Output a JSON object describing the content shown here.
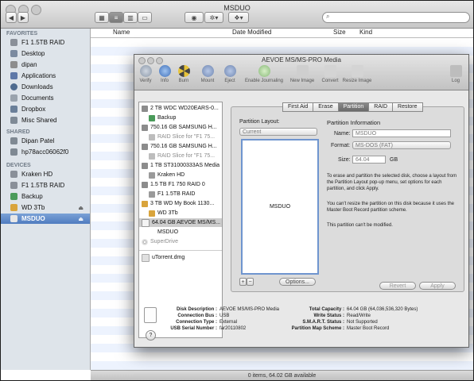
{
  "finder": {
    "title": "MSDUO",
    "columns": {
      "name": "Name",
      "date": "Date Modified",
      "size": "Size",
      "kind": "Kind"
    },
    "status": "0 items, 64.02 GB available",
    "sidebar": {
      "favorites_head": "FAVORITES",
      "shared_head": "SHARED",
      "devices_head": "DEVICES",
      "favorites": [
        "F1 1.5TB RAID",
        "Desktop",
        "dipan",
        "Applications",
        "Downloads",
        "Documents",
        "Dropbox",
        "Misc Shared"
      ],
      "shared": [
        "Dipan Patel",
        "hp78acc06062f0"
      ],
      "devices": [
        "Kraken HD",
        "F1 1.5TB RAID",
        "Backup",
        "WD 3Tb",
        "MSDUO"
      ],
      "eject": "⏏"
    }
  },
  "du": {
    "title": "AEVOE MS/MS-PRO Media",
    "toolbar": [
      "Verify",
      "Info",
      "Burn",
      "Mount",
      "Eject",
      "Enable Journaling",
      "New Image",
      "Convert",
      "Resize Image",
      "Log"
    ],
    "disks": [
      "2 TB WDC WD20EARS-0...",
      "Backup",
      "750.16 GB SAMSUNG H...",
      "RAID Slice for \"F1 75...",
      "750.16 GB SAMSUNG H...",
      "RAID Slice for \"F1 75...",
      "1 TB ST31000333AS Media",
      "Kraken HD",
      "1.5 TB F1 750 RAID 0",
      "F1 1.5TB RAID",
      "3 TB WD My Book 1130...",
      "WD 3Tb",
      "64.04 GB AEVOE MS/MS...",
      "MSDUO",
      "SuperDrive",
      "uTorrent.dmg"
    ],
    "tabs": [
      "First Aid",
      "Erase",
      "Partition",
      "RAID",
      "Restore"
    ],
    "partition": {
      "layout_label": "Partition Layout:",
      "layout_value": "Current",
      "partition_name": "MSDUO",
      "info_title": "Partition Information",
      "name_label": "Name:",
      "name_value": "MSDUO",
      "format_label": "Format:",
      "format_value": "MS-DOS (FAT)",
      "size_label": "Size:",
      "size_value": "64.04",
      "size_unit": "GB",
      "para1": "To erase and partition the selected disk, choose a layout from the Partition Layout pop-up menu, set options for each partition, and click Apply.",
      "para2": "You can't resize the partition on this disk because it uses the Master Boot Record partition scheme.",
      "para3": "This partition can't be modified.",
      "plus": "+",
      "minus": "−",
      "options": "Options...",
      "revert": "Revert",
      "apply": "Apply"
    },
    "info": {
      "disk_description_label": "Disk Description :",
      "disk_description": "AEVOE MS/MS-PRO Media",
      "connection_bus_label": "Connection Bus :",
      "connection_bus": "USB",
      "connection_type_label": "Connection Type :",
      "connection_type": "External",
      "usb_serial_label": "USB Serial Number :",
      "usb_serial": "far20110802",
      "total_capacity_label": "Total Capacity :",
      "total_capacity": "64.04 GB (64,036,536,320 Bytes)",
      "write_status_label": "Write Status :",
      "write_status": "Read/Write",
      "smart_label": "S.M.A.R.T. Status :",
      "smart": "Not Supported",
      "pms_label": "Partition Map Scheme :",
      "pms": "Master Boot Record"
    },
    "help": "?"
  }
}
